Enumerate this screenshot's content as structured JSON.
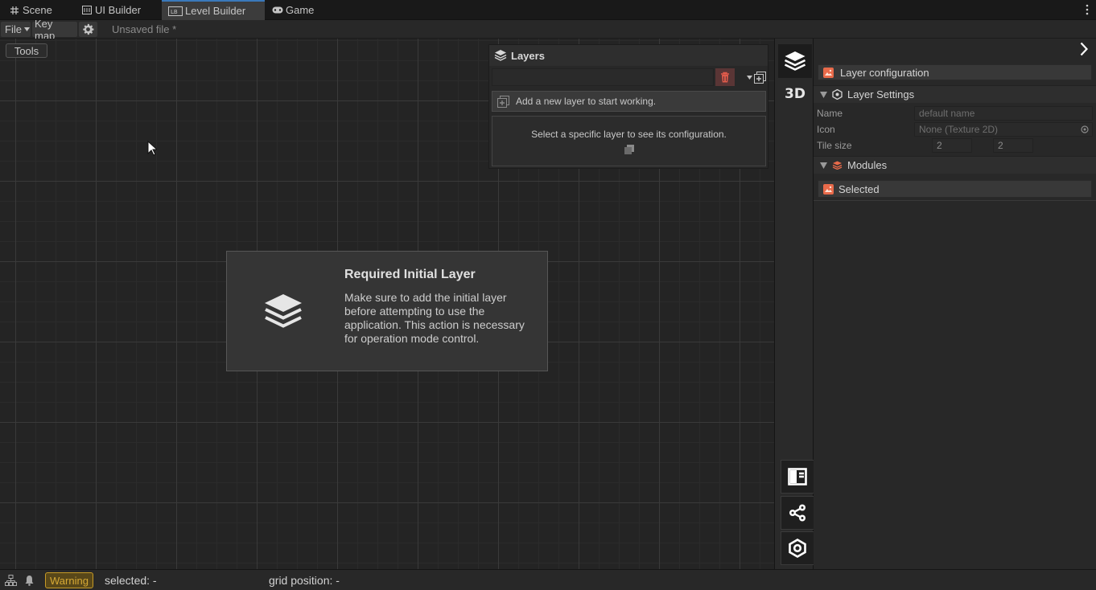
{
  "tabs": [
    {
      "label": "Scene",
      "icon": "grid-icon"
    },
    {
      "label": "UI Builder",
      "icon": "ui-builder-icon"
    },
    {
      "label": "Level Builder",
      "icon": "level-builder-icon",
      "active": true
    },
    {
      "label": "Game",
      "icon": "gamepad-icon"
    }
  ],
  "menubar": {
    "file_label": "File",
    "keymap_label": "Key map",
    "filename": "Unsaved file *"
  },
  "canvas": {
    "tools_label": "Tools"
  },
  "layers_panel": {
    "title": "Layers",
    "add_layer_hint": "Add a new layer to start working.",
    "select_hint": "Select a specific layer to see its configuration."
  },
  "modal": {
    "title": "Required Initial Layer",
    "body": "Make sure to add the initial layer before attempting to use the application. This action is necessary for operation mode control."
  },
  "strip": {
    "label_3d": "3D"
  },
  "inspector": {
    "layer_configuration": "Layer configuration",
    "layer_settings": "Layer Settings",
    "fields": {
      "name_label": "Name",
      "name_placeholder": "default name",
      "icon_label": "Icon",
      "icon_value": "None (Texture 2D)",
      "tile_size_label": "Tile size",
      "tile_x": "2",
      "tile_y": "2"
    },
    "modules": "Modules",
    "selected": "Selected"
  },
  "statusbar": {
    "warning_label": "Warning",
    "selected_text": "selected: -",
    "grid_position_text": "grid position:  -"
  },
  "colors": {
    "accent_blue": "#3a79bb",
    "warning": "#d6a935",
    "delete_red": "#e05b4b",
    "module_orange": "#e86a4a"
  }
}
